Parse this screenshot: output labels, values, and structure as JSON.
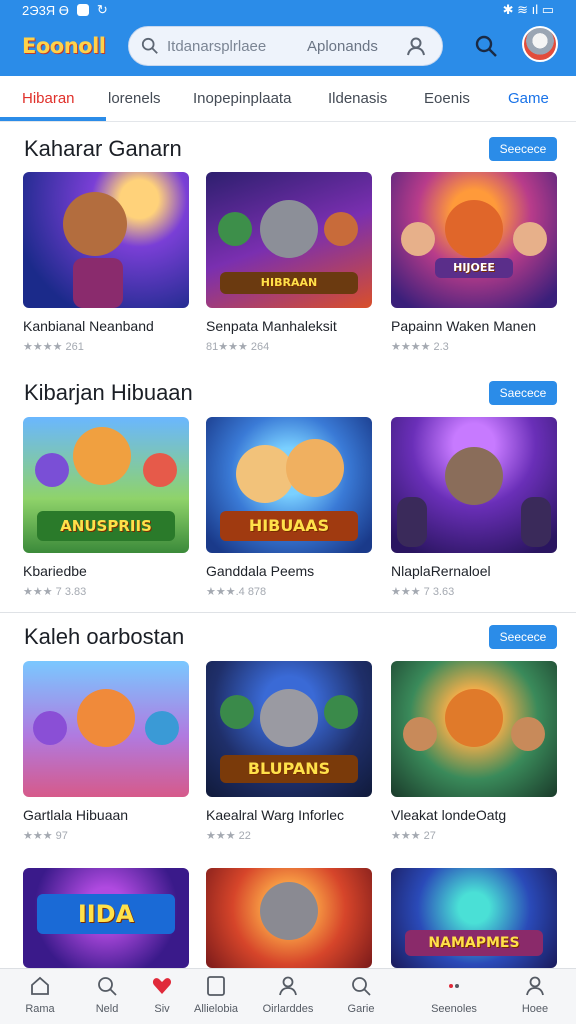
{
  "status": {
    "time": "2Э3Я Ө",
    "icons_right": "✱ ≋ ıl ▭"
  },
  "app": {
    "logo": "Eoonoll",
    "search_placeholder": "Itdanarsplrlaee",
    "search_aux": "Aplonands"
  },
  "tabs": [
    {
      "label": "Hibaran"
    },
    {
      "label": "lorenels"
    },
    {
      "label": "Inopepinplaata"
    },
    {
      "label": "Ildenasis"
    },
    {
      "label": "Eoenis"
    },
    {
      "label": "Game"
    }
  ],
  "sections": [
    {
      "title": "Kaharar Ganarn",
      "button": "Seecece",
      "cards": [
        {
          "name": "Kanbianal Neanband",
          "rating": "★★★★ 261",
          "thumb_label": ""
        },
        {
          "name": "Senpata Manhaleksit",
          "rating": "81★★★ 264",
          "thumb_label": "HIBRAAN"
        },
        {
          "name": "Papainn Waken Manen",
          "rating": "★★★★ 2.3",
          "thumb_label": "HIJOEE"
        }
      ]
    },
    {
      "title": "Kibarjan Hibuaan",
      "button": "Saecece",
      "cards": [
        {
          "name": "Kbariedbe",
          "rating": "★★★ 7 3.83",
          "thumb_label": "ANUSPRIIS"
        },
        {
          "name": "Ganddala Peems",
          "rating": "★★★.4 878",
          "thumb_label": "HIBUAAS"
        },
        {
          "name": "NlaplaRernaloel",
          "rating": "★★★ 7 3.63",
          "thumb_label": ""
        }
      ]
    },
    {
      "title": "Kaleh oarbostan",
      "button": "Seecece",
      "cards": [
        {
          "name": "Gartlala Hibuaan",
          "rating": "★★★ 97",
          "thumb_label": ""
        },
        {
          "name": "Kaealral Warg Inforlec",
          "rating": "★★★ 22",
          "thumb_label": "BLUPANS"
        },
        {
          "name": "Vleakat londeOatg",
          "rating": "★★★ 27",
          "thumb_label": ""
        }
      ]
    }
  ],
  "partial_row": [
    {
      "thumb_label": "IIDA"
    },
    {
      "thumb_label": ""
    },
    {
      "thumb_label": "NAMAPMES"
    }
  ],
  "bottom_nav": [
    {
      "label": "Rama",
      "icon": "home-icon"
    },
    {
      "label": "Neld",
      "icon": "search-icon"
    },
    {
      "label": "Siv",
      "icon": "heart-icon"
    },
    {
      "label": "Allielobia",
      "icon": "tablet-icon"
    },
    {
      "label": "Oirlarddes",
      "icon": "person-icon"
    },
    {
      "label": "Garie",
      "icon": "search-icon"
    },
    {
      "label": "Seenoles",
      "icon": "dots-icon"
    },
    {
      "label": "Hoee",
      "icon": "profile-icon"
    }
  ],
  "colors": {
    "primary": "#2b8ce8",
    "active_tab": "#e0312b",
    "heart": "#e02a3a"
  }
}
